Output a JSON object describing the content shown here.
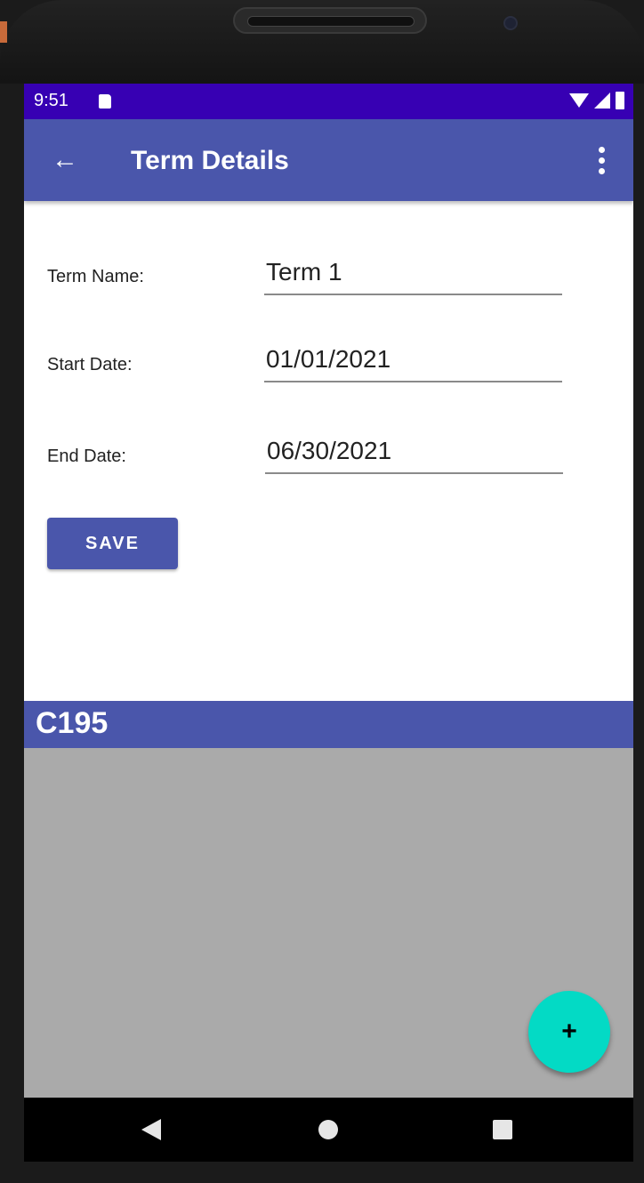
{
  "status_bar": {
    "time": "9:51"
  },
  "app_bar": {
    "back_icon": "arrow-back-icon",
    "back_glyph": "←",
    "title": "Term Details",
    "menu_icon": "more-vert-icon"
  },
  "form": {
    "term_name_label": "Term Name:",
    "term_name_value": "Term 1",
    "start_date_label": "Start Date:",
    "start_date_value": "01/01/2021",
    "end_date_label": "End Date:",
    "end_date_value": "06/30/2021",
    "save_label": "SAVE"
  },
  "courses": {
    "items": [
      {
        "title": "C195"
      }
    ]
  },
  "fab": {
    "icon": "add-icon",
    "glyph": "+"
  },
  "nav_bar": {
    "back_icon": "nav-back-icon",
    "home_icon": "nav-home-icon",
    "recents_icon": "nav-recents-icon"
  },
  "colors": {
    "status_bar": "#3700b3",
    "primary": "#4a56ab",
    "accent": "#03dac5",
    "list_background": "#aaaaaa"
  }
}
